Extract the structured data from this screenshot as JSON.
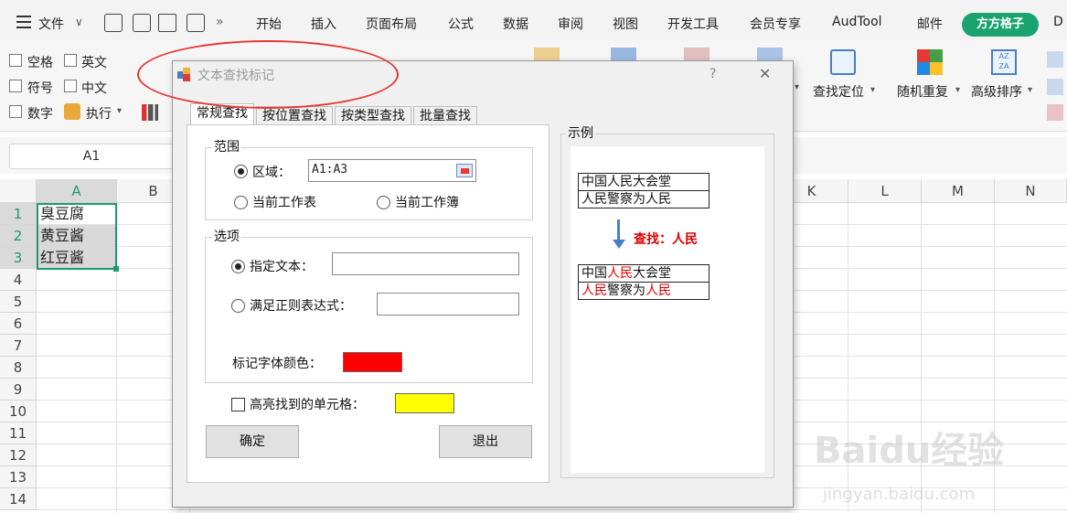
{
  "menu": {
    "file": "文件",
    "tabs": [
      "开始",
      "插入",
      "页面布局",
      "公式",
      "数据",
      "审阅",
      "视图",
      "开发工具",
      "会员专享",
      "AudTool",
      "邮件"
    ],
    "active_tab": "方方格子",
    "more": "D"
  },
  "ribbon": {
    "checks": [
      "空格",
      "英文",
      "符号",
      "中文",
      "数字"
    ],
    "execute": "执行",
    "find_locate": "查找定位",
    "random_repeat": "随机重复",
    "advanced_sort": "高级排序"
  },
  "formula_bar": {
    "name_box": "A1"
  },
  "grid": {
    "columns": [
      "A",
      "B",
      "K",
      "L",
      "M",
      "N"
    ],
    "rows": [
      "1",
      "2",
      "3",
      "4",
      "5",
      "6",
      "7",
      "8",
      "9",
      "10",
      "11",
      "12",
      "13",
      "14"
    ],
    "cells": [
      "臭豆腐",
      "黄豆酱",
      "红豆酱"
    ]
  },
  "dialog": {
    "title": "文本查找标记",
    "help": "?",
    "close": "✕",
    "tabs": [
      "常规查找",
      "按位置查找",
      "按类型查找",
      "批量查找"
    ],
    "range": {
      "title": "范围",
      "area_label": "区域：",
      "area_value": "A1:A3",
      "current_sheet": "当前工作表",
      "current_book": "当前工作簿"
    },
    "options": {
      "title": "选项",
      "specified_text": "指定文本：",
      "regex": "满足正则表达式：",
      "mark_color_label": "标记字体颜色：",
      "mark_color": "#ff0000"
    },
    "highlight_label": "高亮找到的单元格：",
    "highlight_color": "#ffff00",
    "ok": "确定",
    "exit": "退出",
    "example": {
      "title": "示例",
      "before": [
        "中国人民大会堂",
        "人民警察为人民"
      ],
      "search": "查找：人民",
      "after_1": {
        "a": "中国",
        "b": "人民",
        "c": "大会堂"
      },
      "after_2": {
        "a": "人民",
        "b": "警察为",
        "c": "人民"
      }
    }
  },
  "watermark": {
    "main": "Baidu经验",
    "sub": "jingyan.baidu.com"
  }
}
